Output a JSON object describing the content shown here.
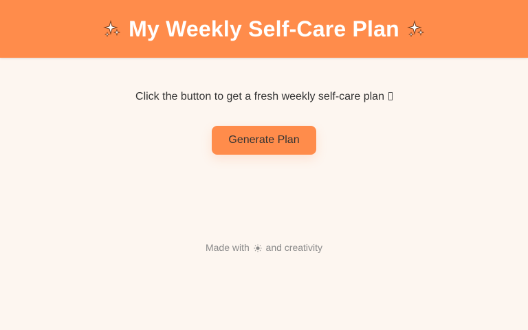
{
  "header": {
    "title": "My Weekly Self-Care Plan",
    "left_icon": "sparkles-icon",
    "right_icon": "sparkles-icon",
    "background_color": "#ff8c4b"
  },
  "main": {
    "intro_text": "Click the button to get a fresh weekly self-care plan",
    "intro_trailing_icon": "missing-glyph-icon",
    "generate_button_label": "Generate Plan",
    "button_color": "#ff8c4b"
  },
  "footer": {
    "text_before": "Made with",
    "icon": "sun-icon",
    "text_after": "and creativity"
  },
  "colors": {
    "accent": "#ff8c4b",
    "page_background": "#fdf6f0",
    "footer_text": "#8a8a8a"
  }
}
